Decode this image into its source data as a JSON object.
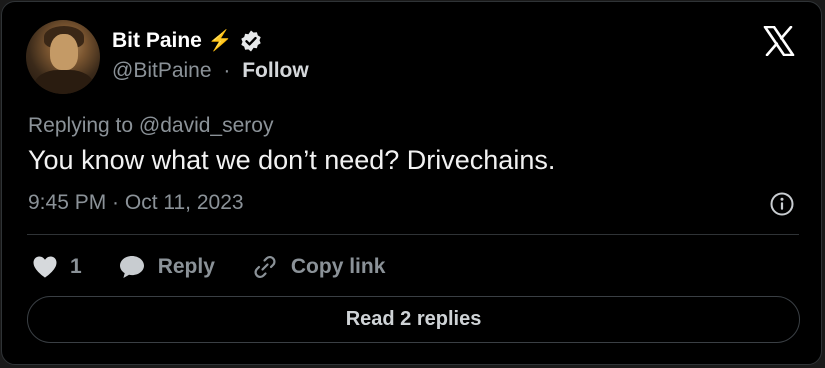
{
  "author": {
    "name": "Bit Paine",
    "emoji": "⚡",
    "handle": "@BitPaine",
    "separator": "·",
    "follow_label": "Follow"
  },
  "tweet": {
    "reply_prefix": "Replying to @david_seroy",
    "text": "You know what we don’t need? Drivechains.",
    "timestamp": "9:45 PM · Oct 11, 2023"
  },
  "actions": {
    "like_count": "1",
    "reply_label": "Reply",
    "copy_link_label": "Copy link"
  },
  "read_replies_label": "Read 2 replies",
  "colors": {
    "background": "#000000",
    "border": "#2f3336",
    "muted_text": "#8b9298",
    "bolt": "#ffcc1a"
  }
}
